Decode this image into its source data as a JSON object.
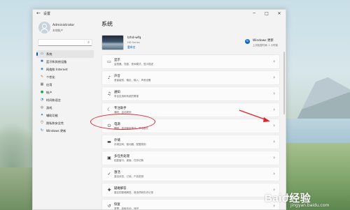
{
  "window": {
    "back_glyph": "←",
    "title": "设置",
    "controls": {
      "min": "─",
      "max": "□",
      "close": "✕"
    }
  },
  "user": {
    "name": "Administrator",
    "role": "本地帐户"
  },
  "search": {
    "icon": "search-icon",
    "glyph": "⌕"
  },
  "nav": {
    "items": [
      {
        "label": "系统",
        "icon": "monitor-icon",
        "glyph": "▭",
        "color": "#0a6bc2",
        "active": true
      },
      {
        "label": "蓝牙和其他设备",
        "icon": "bluetooth-icon",
        "glyph": "✱",
        "color": "#0a6bc2"
      },
      {
        "label": "网络和 Internet",
        "icon": "wifi-icon",
        "glyph": "◈",
        "color": "#0a6bc2"
      },
      {
        "label": "个性化",
        "icon": "brush-icon",
        "glyph": "✎",
        "color": "#c96a1a"
      },
      {
        "label": "应用",
        "icon": "apps-icon",
        "glyph": "▦",
        "color": "#555555"
      },
      {
        "label": "帐户",
        "icon": "account-icon",
        "glyph": "●",
        "color": "#1b9e5a"
      },
      {
        "label": "时间和语言",
        "icon": "clock-globe-icon",
        "glyph": "◔",
        "color": "#0a6bc2"
      },
      {
        "label": "游戏",
        "icon": "gamepad-icon",
        "glyph": "◎",
        "color": "#555555"
      },
      {
        "label": "辅助功能",
        "icon": "accessibility-icon",
        "glyph": "✦",
        "color": "#0a6bc2"
      },
      {
        "label": "隐私和安全性",
        "icon": "shield-icon",
        "glyph": "⛉",
        "color": "#555555"
      },
      {
        "label": "Windows 更新",
        "icon": "update-icon",
        "glyph": "↻",
        "color": "#0a6bc2"
      }
    ]
  },
  "main": {
    "title": "系统",
    "device": {
      "name": "lzhd-wfq",
      "model": "HD Series",
      "rename": "重命名"
    },
    "update": {
      "title": "Windows 更新",
      "subtitle": "上次检查时间: 1 小时前",
      "glyph": "↻"
    },
    "rows": [
      {
        "title": "显示",
        "subtitle": "监视器、亮度、夜间模式、显示描述",
        "icon": "display-icon",
        "glyph": "▭"
      },
      {
        "title": "声音",
        "subtitle": "音量级别、输出、输入、声音设备",
        "icon": "speaker-icon",
        "glyph": "♪"
      },
      {
        "title": "通知",
        "subtitle": "来自应用和系统的警报",
        "icon": "bell-icon",
        "glyph": "♫"
      },
      {
        "title": "专注助手",
        "subtitle": "通知、自动规则",
        "icon": "moon-icon",
        "glyph": "☾"
      },
      {
        "title": "电源",
        "subtitle": "睡眠、电池使用情况、节电模式",
        "icon": "power-icon",
        "glyph": "⏻"
      },
      {
        "title": "存储",
        "subtitle": "存储空间、驱动器、配置规则",
        "icon": "storage-icon",
        "glyph": "▬"
      },
      {
        "title": "多任务处理",
        "subtitle": "贴靠窗口、桌面、任务切换",
        "icon": "multitask-icon",
        "glyph": "▣"
      },
      {
        "title": "激活",
        "subtitle": "激活状态、订阅、产品密钥",
        "icon": "check-icon",
        "glyph": "✓"
      },
      {
        "title": "疑难解答",
        "subtitle": "建议的疑难解答、首选项和历史记录",
        "icon": "wrench-icon",
        "glyph": "✚"
      },
      {
        "title": "恢复",
        "subtitle": "重置、高级启动、返回",
        "icon": "recovery-icon",
        "glyph": "↺"
      }
    ],
    "chevron": "›"
  },
  "annotation": {
    "color": "#e0212a",
    "highlight": "power-row"
  },
  "watermark": {
    "brand": "Baiժ经验",
    "url": "jingyan.baidu.com"
  }
}
